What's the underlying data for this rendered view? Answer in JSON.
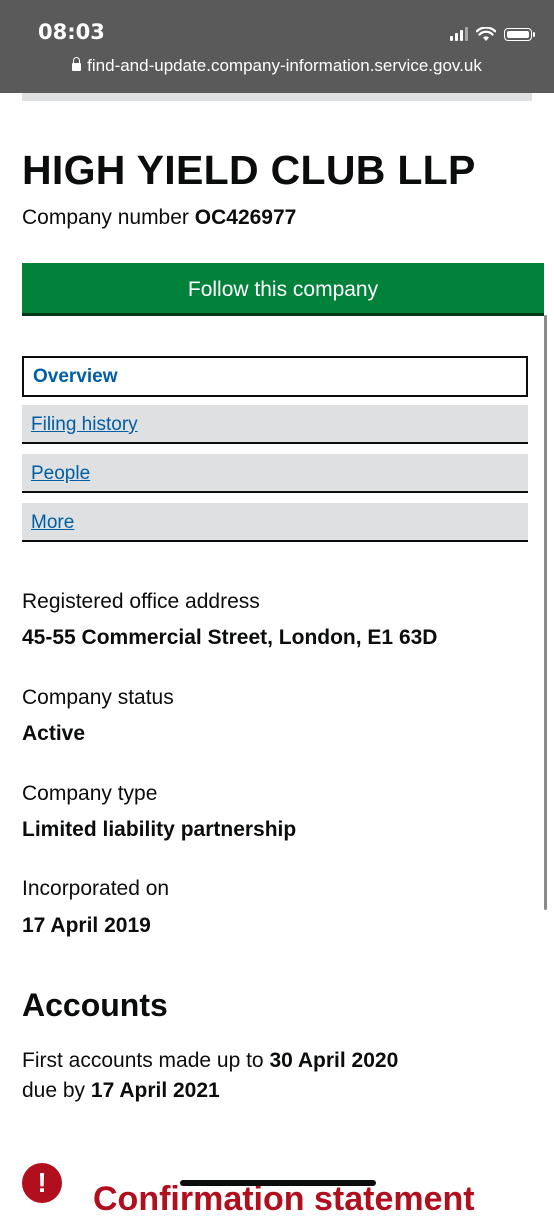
{
  "status_bar": {
    "time": "08:03",
    "url": "find-and-update.company-information.service.gov.uk",
    "icons": [
      "signal-icon",
      "wifi-icon",
      "battery-icon",
      "lock-icon"
    ]
  },
  "company": {
    "name": "HIGH YIELD CLUB LLP",
    "number_label": "Company number",
    "number": "OC426977",
    "follow_label": "Follow this company"
  },
  "tabs": [
    {
      "label": "Overview",
      "active": true
    },
    {
      "label": "Filing history",
      "active": false
    },
    {
      "label": "People",
      "active": false
    },
    {
      "label": "More",
      "active": false
    }
  ],
  "fields": [
    {
      "label": "Registered office address",
      "value": "45-55 Commercial Street, London, E1 63D"
    },
    {
      "label": "Company status",
      "value": "Active"
    },
    {
      "label": "Company type",
      "value": "Limited liability partnership"
    },
    {
      "label": "Incorporated on",
      "value": "17 April 2019"
    }
  ],
  "accounts": {
    "heading": "Accounts",
    "line1_prefix": "First accounts made up to",
    "line1_date": "30 April 2020",
    "line2_prefix": "due by",
    "line2_date": "17 April 2021"
  },
  "confirmation": {
    "heading": "Confirmation statement",
    "icon_text": "!"
  },
  "colors": {
    "follow_button": "#00823b",
    "link": "#005ea5",
    "warning": "#b10e1e",
    "tab_bg": "#dee0e2"
  }
}
